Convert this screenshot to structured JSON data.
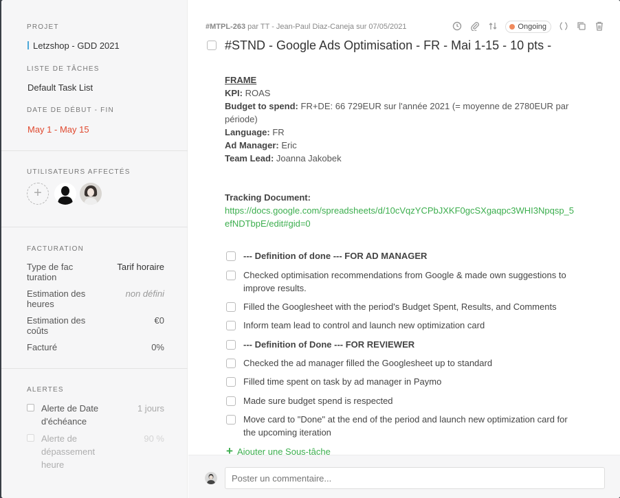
{
  "sidebar": {
    "project_label": "PROJET",
    "project_value": "Letzshop - GDD 2021",
    "tasklist_label": "LISTE DE TÂCHES",
    "tasklist_value": "Default Task List",
    "dates_label": "DATE DE DÉBUT - FIN",
    "dates_value": "May 1 - May 15",
    "users_label": "UTILISATEURS AFFECTÉS",
    "billing_label": "FACTURATION",
    "billing": [
      {
        "label": "Type de fac turation",
        "value": "Tarif horaire"
      },
      {
        "label": "Estimation des heures",
        "value": "non défini"
      },
      {
        "label": "Estimation des coûts",
        "value": "€0"
      },
      {
        "label": "Facturé",
        "value": "0%"
      }
    ],
    "alerts_label": "ALERTES",
    "alerts": [
      {
        "label": "Alerte de Date d'échéance",
        "value": "1 jours"
      },
      {
        "label": "Alerte de dépassement heure",
        "value": "90 %"
      }
    ]
  },
  "header": {
    "task_id": "#MTPL-263",
    "meta": "par TT - Jean-Paul Diaz-Caneja sur 07/05/2021",
    "status": "Ongoing",
    "title": "#STND - Google Ads Optimisation - FR - Mai 1-15 - 10 pts -"
  },
  "description": {
    "frame_heading": "FRAME",
    "kpi_label": "KPI:",
    "kpi_value": "ROAS",
    "budget_label": "Budget to spend:",
    "budget_value": "FR+DE: 66 729EUR sur l'année 2021 (= moyenne de 2780EUR par période)",
    "language_label": "Language:",
    "language_value": "FR",
    "admanager_label": "Ad Manager:",
    "admanager_value": "Eric",
    "teamlead_label": "Team Lead:",
    "teamlead_value": "Joanna Jakobek",
    "tracking_label": "Tracking Document:",
    "tracking_link": "https://docs.google.com/spreadsheets/d/10cVqzYCPbJXKF0gcSXgaqpc3WHI3Npqsp_5efNDTbpE/edit#gid=0"
  },
  "subtasks": [
    {
      "text": "--- Definition of done --- FOR AD MANAGER",
      "bold": true
    },
    {
      "text": "Checked optimisation recommendations from Google & made own suggestions to improve results.",
      "bold": false
    },
    {
      "text": "Filled the Googlesheet with the period's Budget Spent, Results, and Comments",
      "bold": false
    },
    {
      "text": "Inform team lead to control and launch new optimization card",
      "bold": false
    },
    {
      "text": "--- Definition of Done --- FOR REVIEWER",
      "bold": true
    },
    {
      "text": "Checked the ad manager filled the Googlesheet up to standard",
      "bold": false
    },
    {
      "text": "Filled time spent on task by ad manager in Paymo",
      "bold": false
    },
    {
      "text": "Made sure budget spend is respected",
      "bold": false
    },
    {
      "text": "Move card to \"Done\" at the end of the period and launch new optimization card for the upcoming iteration",
      "bold": false
    }
  ],
  "add_subtask_label": "Ajouter une Sous-tâche",
  "comment_placeholder": "Poster un commentaire...",
  "colors": {
    "accent": "#3cae4e",
    "date_red": "#e0492f",
    "status_dot": "#f08a5d"
  }
}
